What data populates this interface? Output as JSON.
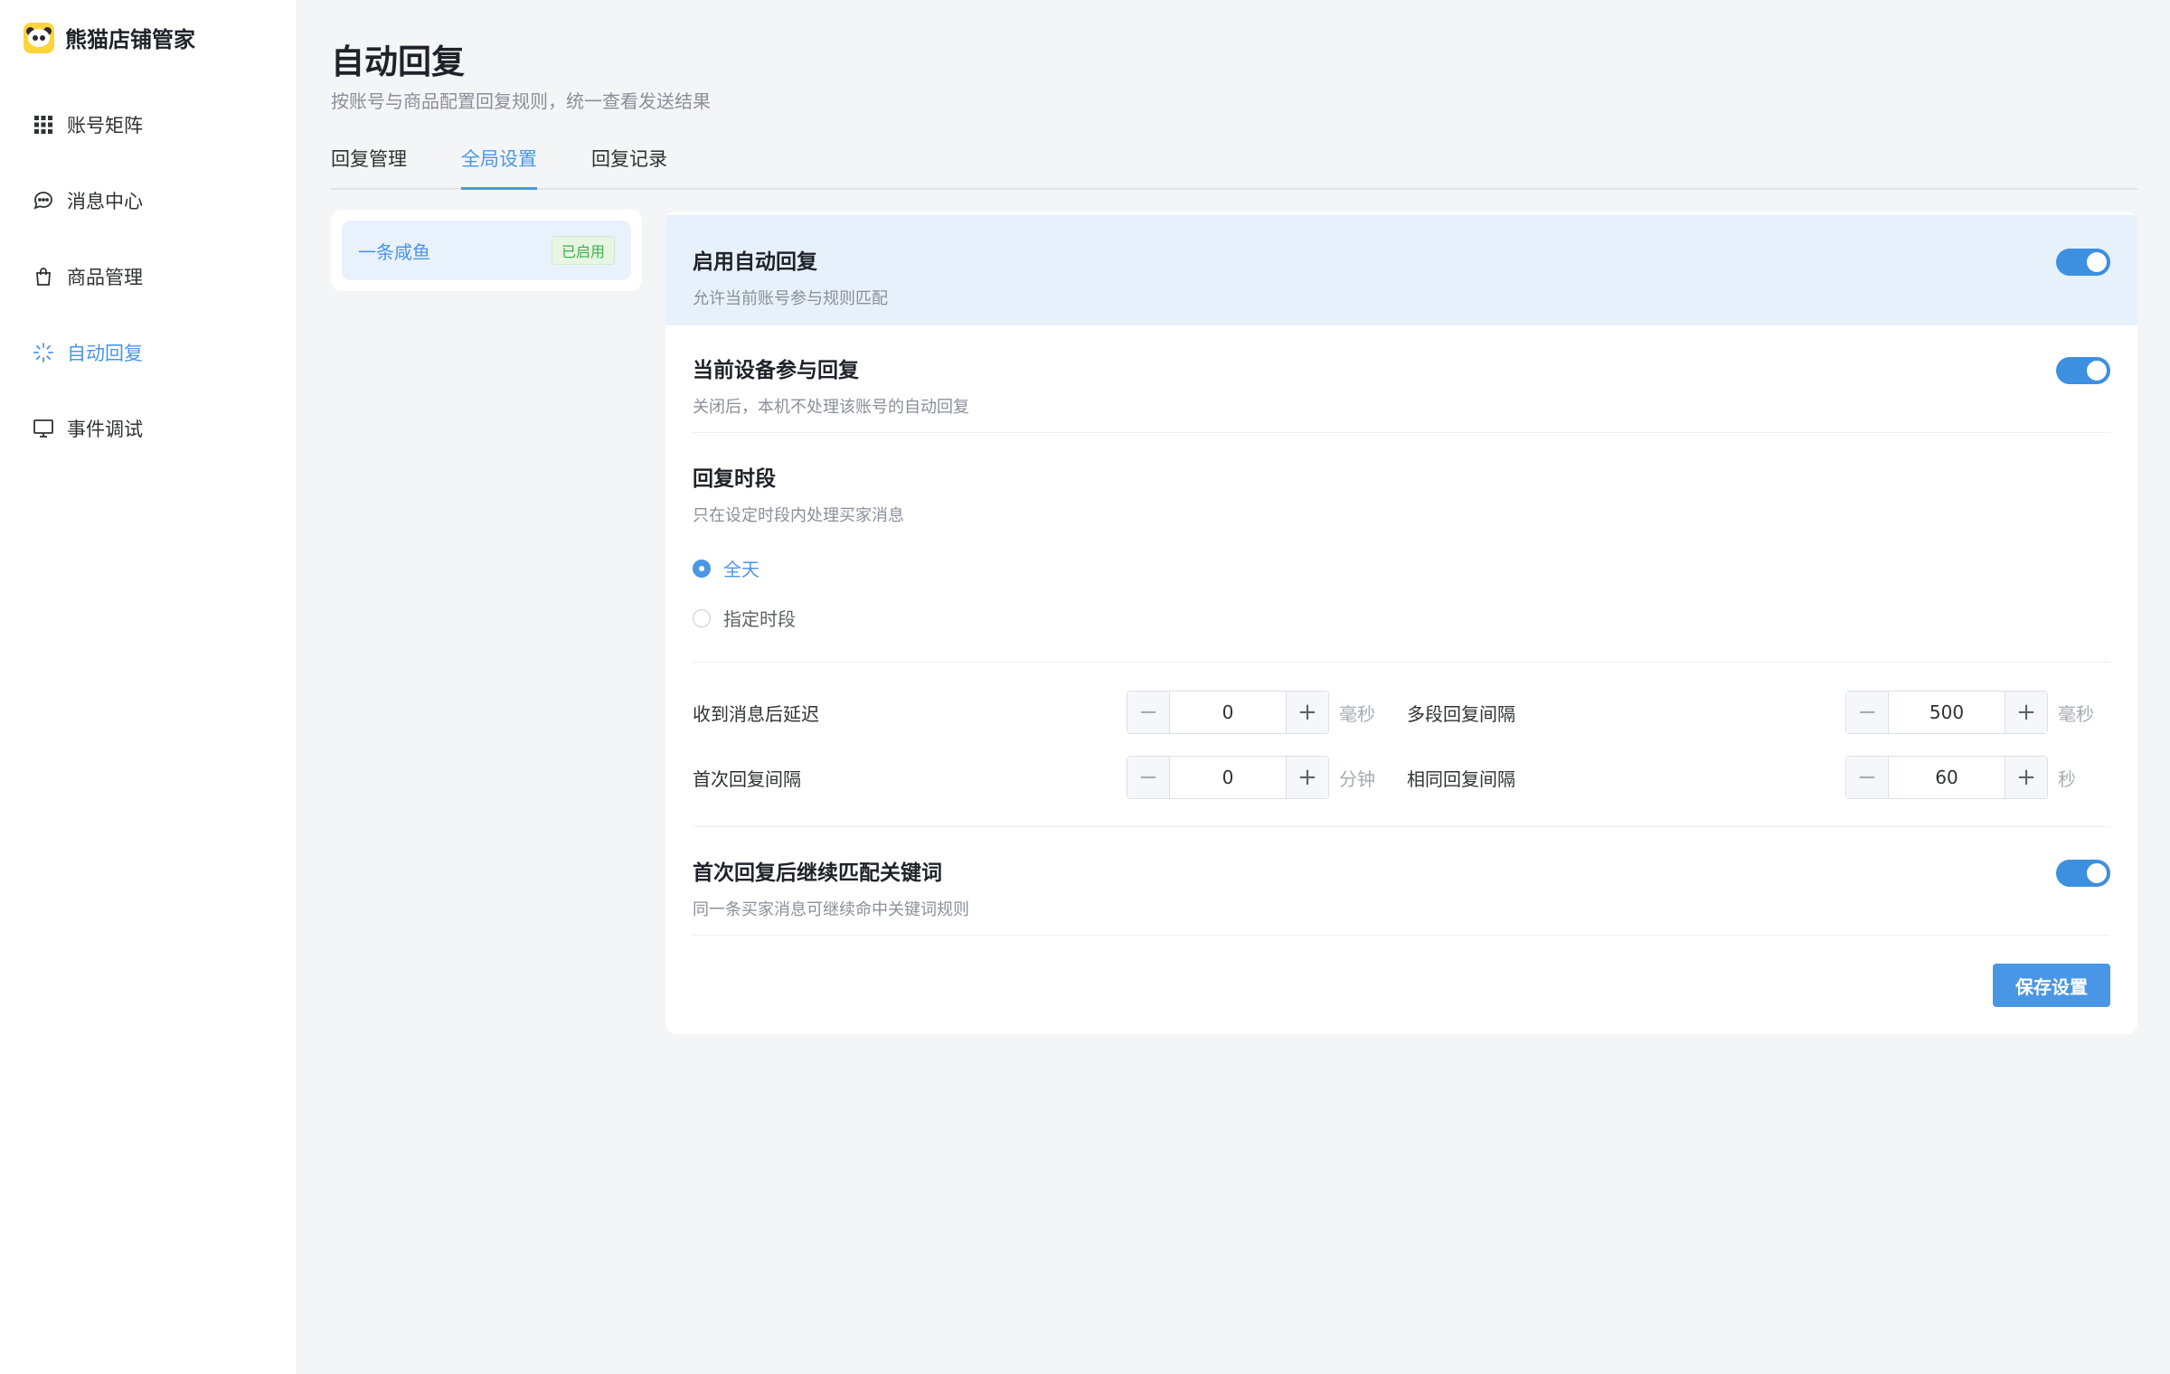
{
  "brand": {
    "name": "熊猫店铺管家",
    "logo_icon": "panda-icon"
  },
  "sidebar": {
    "items": [
      {
        "label": "账号矩阵",
        "icon": "grid-icon",
        "active": false
      },
      {
        "label": "消息中心",
        "icon": "chat-bubble-icon",
        "active": false
      },
      {
        "label": "商品管理",
        "icon": "shopping-bag-icon",
        "active": false
      },
      {
        "label": "自动回复",
        "icon": "loader-icon",
        "active": true
      },
      {
        "label": "事件调试",
        "icon": "monitor-icon",
        "active": false
      }
    ]
  },
  "header": {
    "title": "自动回复",
    "subtitle": "按账号与商品配置回复规则，统一查看发送结果"
  },
  "tabs": [
    {
      "label": "回复管理",
      "active": false
    },
    {
      "label": "全局设置",
      "active": true
    },
    {
      "label": "回复记录",
      "active": false
    }
  ],
  "accounts": [
    {
      "name": "一条咸鱼",
      "badge": "已启用"
    }
  ],
  "settings": {
    "enable_auto_reply": {
      "title": "启用自动回复",
      "desc": "允许当前账号参与规则匹配",
      "on": true
    },
    "device_participate": {
      "title": "当前设备参与回复",
      "desc": "关闭后，本机不处理该账号的自动回复",
      "on": true
    },
    "reply_period": {
      "title": "回复时段",
      "desc": "只在设定时段内处理买家消息",
      "options": [
        "全天",
        "指定时段"
      ],
      "selected": "全天"
    },
    "delay_after_message": {
      "label": "收到消息后延迟",
      "value": "0",
      "unit": "毫秒"
    },
    "multi_segment_interval": {
      "label": "多段回复间隔",
      "value": "500",
      "unit": "毫秒"
    },
    "first_reply_interval": {
      "label": "首次回复间隔",
      "value": "0",
      "unit": "分钟"
    },
    "same_reply_interval": {
      "label": "相同回复间隔",
      "value": "60",
      "unit": "秒"
    },
    "continue_keyword_match": {
      "title": "首次回复后继续匹配关键词",
      "desc": "同一条买家消息可继续命中关键词规则",
      "on": true
    },
    "stepper_minus": "−",
    "stepper_plus": "+",
    "save_label": "保存设置"
  },
  "colors": {
    "accent": "#4a96e6",
    "toggle_on": "#3d8fe0",
    "badge_green": "#3fae4a",
    "highlight_row": "#e7f1fc"
  }
}
